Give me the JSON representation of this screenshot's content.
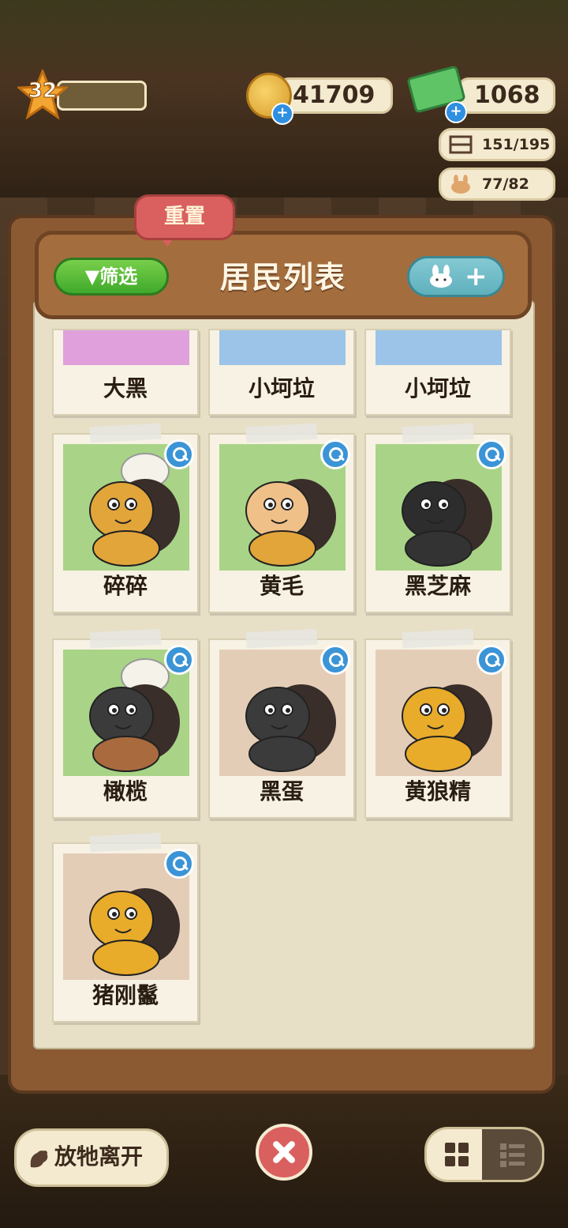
{
  "hud": {
    "level": "32",
    "coins": "41709",
    "cash": "1068",
    "capacity": "151/195",
    "residents_count": "77/82"
  },
  "panel": {
    "title": "居民列表",
    "filter_label": "▼筛选",
    "reset_label": "重置",
    "add_label": "+"
  },
  "residents_partial": [
    {
      "name": "大黑",
      "bg": "#dfa0dc"
    },
    {
      "name": "小坷垃",
      "bg": "#9bc4e8"
    },
    {
      "name": "小坷垃",
      "bg": "#9bc4e8"
    }
  ],
  "residents": [
    {
      "name": "碎碎",
      "bg": "#a9d487",
      "fur": "#e2a53a",
      "chef": true,
      "body": "#e2a53a"
    },
    {
      "name": "黄毛",
      "bg": "#a9d487",
      "fur": "#f0c089",
      "chef": false,
      "body": "#e2a53a"
    },
    {
      "name": "黑芝麻",
      "bg": "#a9d487",
      "fur": "#2d2d2d",
      "chef": false,
      "body": "#333333"
    },
    {
      "name": "橄榄",
      "bg": "#a9d487",
      "fur": "#3b3b3b",
      "chef": true,
      "body": "#a96a3e"
    },
    {
      "name": "黑蛋",
      "bg": "#e4cdb7",
      "fur": "#3b3b3b",
      "chef": false,
      "body": "#3b3b3b"
    },
    {
      "name": "黄狼精",
      "bg": "#e4cdb7",
      "fur": "#e8ab2a",
      "chef": false,
      "body": "#e8ab2a"
    },
    {
      "name": "猪刚鬣",
      "bg": "#e4cdb7",
      "fur": "#e8ab2a",
      "chef": false,
      "body": "#e8ab2a"
    }
  ],
  "bottom": {
    "release_label": "放牠离开"
  },
  "colors": {
    "accent_green": "#3fa92b",
    "accent_red": "#d9605f",
    "accent_teal": "#5fb0bd"
  }
}
